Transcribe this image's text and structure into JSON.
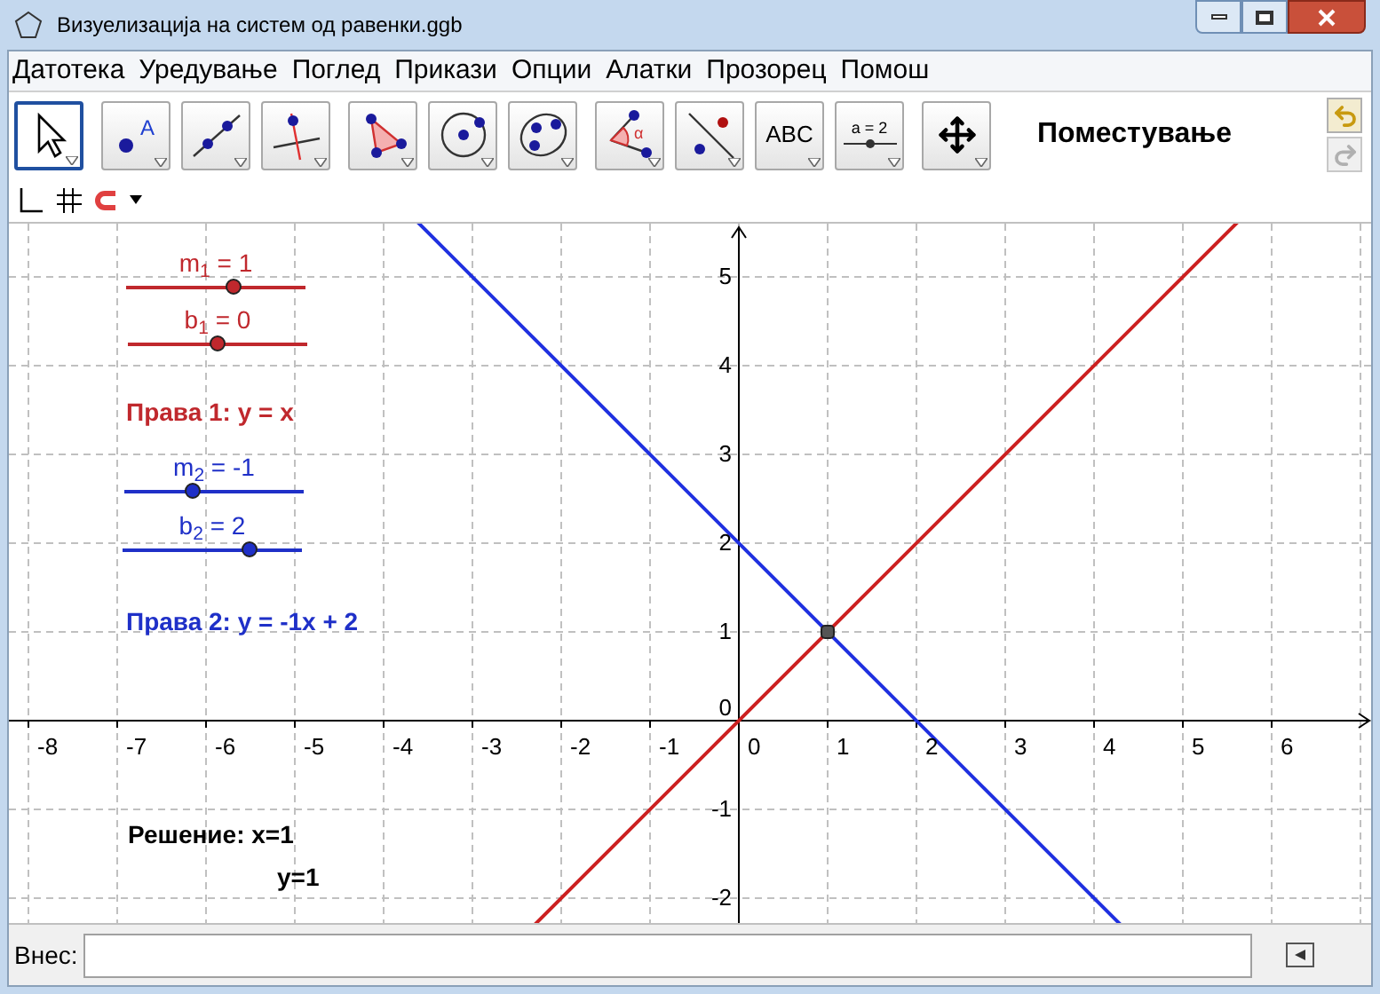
{
  "window": {
    "title": "Визуелизација на систем од равенки.ggb"
  },
  "menu": [
    "Датотека",
    "Уредување",
    "Поглед",
    "Прикази",
    "Опции",
    "Алатки",
    "Прозорец",
    "Помош"
  ],
  "toolbar": {
    "groups": [
      [
        {
          "kind": "pointer",
          "selected": true
        }
      ],
      [
        {
          "kind": "point",
          "selected": false,
          "label": "A"
        },
        {
          "kind": "line",
          "selected": false
        },
        {
          "kind": "perpendicular",
          "selected": false
        }
      ],
      [
        {
          "kind": "polygon",
          "selected": false
        },
        {
          "kind": "circle",
          "selected": false
        },
        {
          "kind": "conic",
          "selected": false
        }
      ],
      [
        {
          "kind": "angle",
          "selected": false,
          "label": "α"
        },
        {
          "kind": "reflect",
          "selected": false
        },
        {
          "kind": "text",
          "selected": false,
          "label": "ABC"
        },
        {
          "kind": "slider",
          "selected": false,
          "label": "a = 2"
        }
      ],
      [
        {
          "kind": "move-view",
          "selected": false
        }
      ]
    ],
    "mode_label": "Поместување"
  },
  "graphics": {
    "x_ticks": [
      "-8",
      "-7",
      "-6",
      "-5",
      "-4",
      "-3",
      "-2",
      "-1",
      "0",
      "1",
      "2",
      "3",
      "4",
      "5",
      "6"
    ],
    "y_ticks": [
      "5",
      "4",
      "3",
      "2",
      "1",
      "0",
      "-1",
      "-2"
    ],
    "sliders": [
      {
        "label": "m$_{1}$ = 1",
        "level": 0.6,
        "color": "#c0282d"
      },
      {
        "label": "b$_{1}$ = 0",
        "level": 0.5,
        "color": "#c0282d"
      },
      {
        "label": "m$_{2}$ = -1",
        "level": 0.38,
        "color": "#1f30c8"
      },
      {
        "label": "b$_{2}$ = 2",
        "level": 0.71,
        "color": "#1f30c8"
      }
    ],
    "texts": [
      {
        "text": "Права 1: y = x",
        "color": "#c0282d"
      },
      {
        "text": "Права 2: y = -1x + 2",
        "color": "#1f30c8"
      }
    ],
    "solution": [
      "Решение: x=1",
      "y=1"
    ]
  },
  "input_bar": {
    "label": "Внес:"
  }
}
